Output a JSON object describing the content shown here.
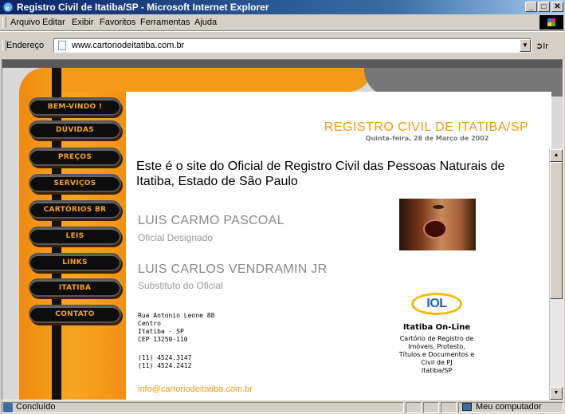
{
  "window": {
    "title": "Registro Civil de Itatiba/SP - Microsoft Internet Explorer"
  },
  "menu": {
    "items": [
      "Arquivo",
      "Editar",
      "Exibir",
      "Favoritos",
      "Ferramentas",
      "Ajuda"
    ]
  },
  "address_bar": {
    "label": "Endereço",
    "url": "www.cartoriodeitatiba.com.br",
    "go_label": "Ir"
  },
  "nav": {
    "items": [
      "BEM-VINDO !",
      "DÚVIDAS",
      "PREÇOS",
      "SERVIÇOS",
      "CARTÓRIOS BR",
      "LEIS",
      "LINKS",
      "ITATIBA",
      "CONTATO"
    ]
  },
  "page": {
    "title": "REGISTRO CIVIL DE ITATIBA/SP",
    "date": "Quinta-feira, 28 de Março de 2002",
    "intro": "Este é o site do Oficial de Registro Civil das Pessoas Naturais de Itatiba, Estado de São Paulo",
    "official_name": "LUIS CARMO PASCOAL",
    "official_role": "Oficial Designado",
    "substitute_name": "LUIS CARLOS VENDRAMIN JR",
    "substitute_role": "Substituto do Oficial",
    "address_lines": [
      "Rua Antonio Leone 88",
      "Centro",
      "Itatiba - SP",
      "CEP 13250-110"
    ],
    "phones": [
      "(11) 4524.3147",
      "(11) 4524.2412"
    ],
    "email": "info@cartoriodeitatiba.com.br",
    "partner": {
      "logo_text": "IOL",
      "title": "Itatiba On-Line",
      "description_lines": [
        "Cartório de Registro de",
        "Imóveis, Protesto,",
        "Títulos e Documentos e",
        "Civil de PJ",
        "Itatiba/SP"
      ]
    }
  },
  "status": {
    "text": "Concluído",
    "zone": "Meu computador"
  },
  "colors": {
    "accent_orange": "#f29a13",
    "nav_bg": "#0d0d0d",
    "titlebar": "#0a246a"
  }
}
